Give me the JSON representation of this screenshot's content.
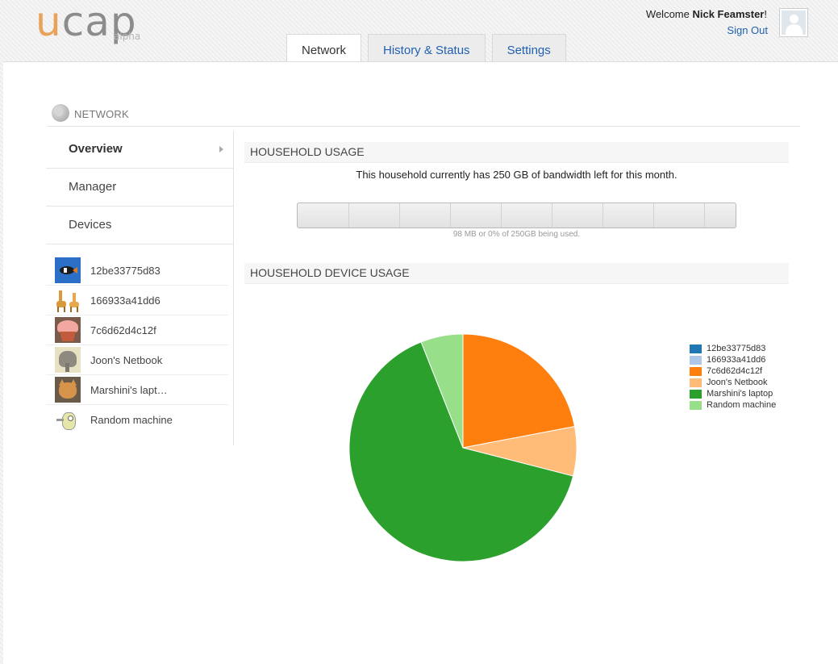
{
  "logo": {
    "u": "u",
    "cap": "cap",
    "alpha": "alpha"
  },
  "header": {
    "welcome_prefix": "Welcome ",
    "user_name": "Nick Feamster",
    "welcome_suffix": "!",
    "sign_out": "Sign Out"
  },
  "tabs": [
    {
      "label": "Network",
      "active": true
    },
    {
      "label": "History & Status",
      "active": false
    },
    {
      "label": "Settings",
      "active": false
    }
  ],
  "section": {
    "title": "NETWORK",
    "icon": "globe-icon"
  },
  "sidebar": {
    "nav": [
      {
        "label": "Overview",
        "active": true
      },
      {
        "label": "Manager",
        "active": false
      },
      {
        "label": "Devices",
        "active": false
      }
    ],
    "devices": [
      {
        "name": "12be33775d83",
        "thumb": "fish-thumbnail"
      },
      {
        "name": "166933a41dd6",
        "thumb": "giraffes-thumbnail"
      },
      {
        "name": "7c6d62d4c12f",
        "thumb": "cupcake-thumbnail"
      },
      {
        "name": "Joon's Netbook",
        "thumb": "elephant-thumbnail"
      },
      {
        "name": "Marshini's lapt…",
        "thumb": "cat-thumbnail"
      },
      {
        "name": "Random machine",
        "thumb": "robot-thumbnail"
      }
    ]
  },
  "household_usage": {
    "title": "HOUSEHOLD USAGE",
    "message": "This household currently has 250 GB of bandwidth left for this month.",
    "bar_caption": "98 MB or 0% of 250GB being used.",
    "used_fraction": 0.0
  },
  "device_usage": {
    "title": "HOUSEHOLD DEVICE USAGE"
  },
  "chart_data": {
    "type": "pie",
    "labels": [
      "12be33775d83",
      "166933a41dd6",
      "7c6d62d4c12f",
      "Joon's Netbook",
      "Marshini's laptop",
      "Random machine"
    ],
    "values": [
      0,
      0,
      22,
      7,
      65,
      6
    ],
    "colors": [
      "#1f77b4",
      "#aec7e8",
      "#ff7f0e",
      "#ffbb78",
      "#2ca02c",
      "#98df8a"
    ],
    "legend_position": "right"
  }
}
